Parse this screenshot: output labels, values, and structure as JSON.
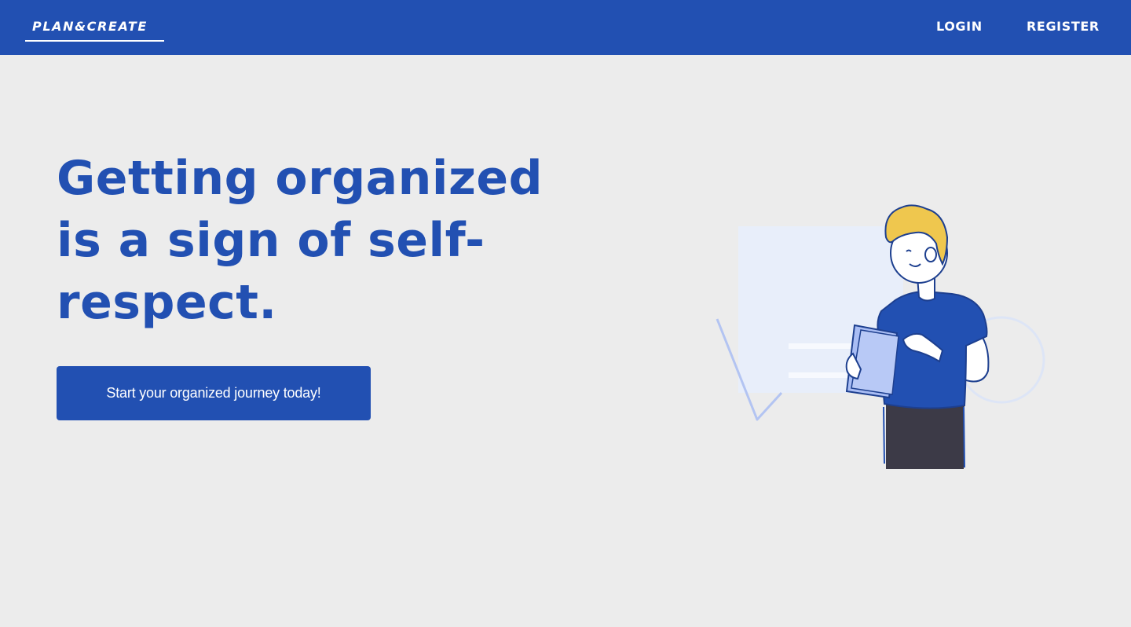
{
  "navbar": {
    "brand": "PLAN&CREATE",
    "links": [
      {
        "label": "LOGIN"
      },
      {
        "label": "REGISTER"
      }
    ]
  },
  "hero": {
    "headline": "Getting organized is a sign of self-respect.",
    "cta_label": "Start your organized journey today!"
  },
  "colors": {
    "primary": "#2250b2",
    "background": "#ececec",
    "accent_hair": "#efc74e",
    "pants": "#3c3a47",
    "light_panel": "#e8eefa",
    "clipboard": "#a9bdf4"
  },
  "illustration": {
    "icon": "person-with-clipboard-illustration"
  }
}
